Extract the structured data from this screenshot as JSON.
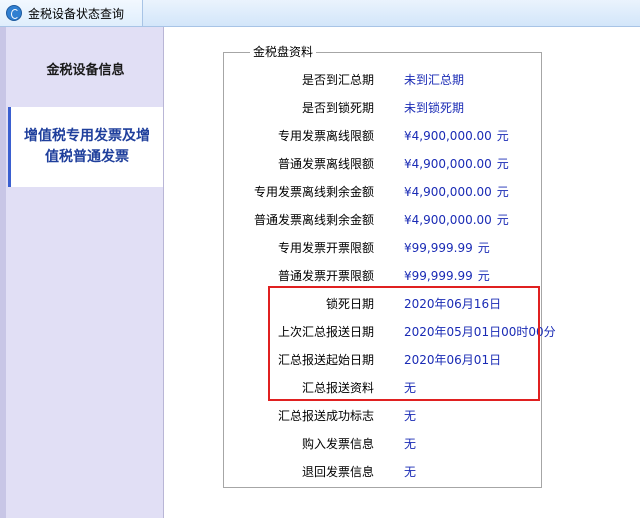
{
  "window": {
    "title": "金税设备状态查询"
  },
  "sidebar": {
    "items": [
      {
        "label": "金税设备信息"
      },
      {
        "label": "增值税专用发票及增值税普通发票"
      }
    ]
  },
  "panel": {
    "group_title": "金税盘资料",
    "rows": [
      {
        "label": "是否到汇总期",
        "value": "未到汇总期"
      },
      {
        "label": "是否到锁死期",
        "value": "未到锁死期"
      },
      {
        "label": "专用发票离线限额",
        "value": "¥4,900,000.00",
        "unit": "元"
      },
      {
        "label": "普通发票离线限额",
        "value": "¥4,900,000.00",
        "unit": "元"
      },
      {
        "label": "专用发票离线剩余金额",
        "value": "¥4,900,000.00",
        "unit": "元"
      },
      {
        "label": "普通发票离线剩余金额",
        "value": "¥4,900,000.00",
        "unit": "元"
      },
      {
        "label": "专用发票开票限额",
        "value": "¥99,999.99",
        "unit": "元"
      },
      {
        "label": "普通发票开票限额",
        "value": "¥99,999.99",
        "unit": "元"
      },
      {
        "label": "锁死日期",
        "value": "2020年06月16日"
      },
      {
        "label": "上次汇总报送日期",
        "value": "2020年05月01日00时00分"
      },
      {
        "label": "汇总报送起始日期",
        "value": "2020年06月01日"
      },
      {
        "label": "汇总报送资料",
        "value": "无"
      },
      {
        "label": "汇总报送成功标志",
        "value": "无"
      },
      {
        "label": "购入发票信息",
        "value": "无"
      },
      {
        "label": "退回发票信息",
        "value": "无"
      }
    ]
  },
  "colors": {
    "value_text": "#1a2bb5",
    "highlight": "#e02020",
    "sidebar_bg": "#e1dff5",
    "active_nav_text": "#1f3f9c"
  }
}
